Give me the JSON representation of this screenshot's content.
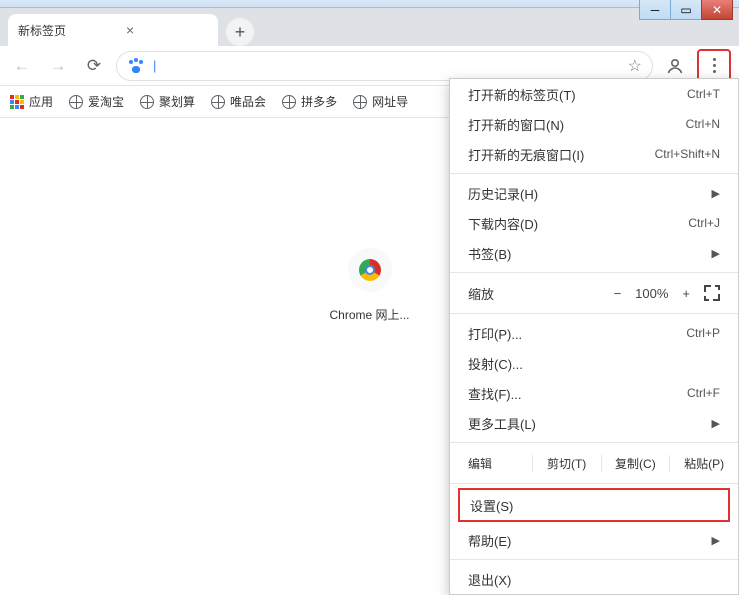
{
  "tab": {
    "title": "新标签页"
  },
  "bookmarks": {
    "apps": "应用",
    "items": [
      "爱淘宝",
      "聚划算",
      "唯品会",
      "拼多多",
      "网址导"
    ]
  },
  "content": {
    "storeLabel": "Chrome 网上..."
  },
  "menu": {
    "newTab": {
      "label": "打开新的标签页(T)",
      "shortcut": "Ctrl+T"
    },
    "newWindow": {
      "label": "打开新的窗口(N)",
      "shortcut": "Ctrl+N"
    },
    "incognito": {
      "label": "打开新的无痕窗口(I)",
      "shortcut": "Ctrl+Shift+N"
    },
    "history": {
      "label": "历史记录(H)"
    },
    "downloads": {
      "label": "下载内容(D)",
      "shortcut": "Ctrl+J"
    },
    "bookmarks": {
      "label": "书签(B)"
    },
    "zoom": {
      "label": "缩放",
      "value": "100%"
    },
    "print": {
      "label": "打印(P)...",
      "shortcut": "Ctrl+P"
    },
    "cast": {
      "label": "投射(C)..."
    },
    "find": {
      "label": "查找(F)...",
      "shortcut": "Ctrl+F"
    },
    "moreTools": {
      "label": "更多工具(L)"
    },
    "edit": {
      "label": "编辑",
      "cut": "剪切(T)",
      "copy": "复制(C)",
      "paste": "粘贴(P)"
    },
    "settings": {
      "label": "设置(S)"
    },
    "help": {
      "label": "帮助(E)"
    },
    "exit": {
      "label": "退出(X)"
    }
  }
}
